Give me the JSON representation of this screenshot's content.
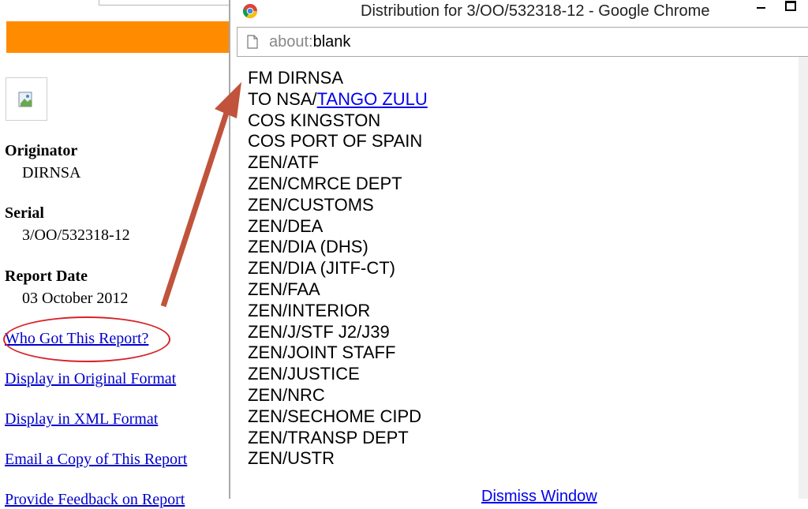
{
  "background_page": {
    "originator_label": "Originator",
    "originator_value": "DIRNSA",
    "serial_label": "Serial",
    "serial_value": "3/OO/532318-12",
    "report_date_label": "Report Date",
    "report_date_value": "03 October 2012",
    "links": {
      "who_got": "Who Got This Report?",
      "original_format": "Display in Original Format",
      "xml_format": "Display in XML Format",
      "email_copy": "Email a Copy of This Report",
      "feedback": "Provide Feedback on Report"
    },
    "colors": {
      "banner": "#ff8c00",
      "highlight": "#d9222a",
      "arrow": "#c0533b"
    }
  },
  "popup": {
    "window_title": "Distribution for 3/OO/532318-12 - Google Chrome",
    "address_prefix": "about:",
    "address_rest": "blank",
    "lines": {
      "fm": "FM DIRNSA",
      "to_prefix": "TO NSA/",
      "to_link": "TANGO ZULU",
      "l3": "COS KINGSTON",
      "l4": "COS PORT OF SPAIN",
      "l5": "ZEN/ATF",
      "l6": "ZEN/CMRCE DEPT",
      "l7": "ZEN/CUSTOMS",
      "l8": "ZEN/DEA",
      "l9": "ZEN/DIA (DHS)",
      "l10": "ZEN/DIA (JITF-CT)",
      "l11": "ZEN/FAA",
      "l12": "ZEN/INTERIOR",
      "l13": "ZEN/J/STF J2/J39",
      "l14": "ZEN/JOINT STAFF",
      "l15": "ZEN/JUSTICE",
      "l16": "ZEN/NRC",
      "l17": "ZEN/SECHOME CIPD",
      "l18": "ZEN/TRANSP DEPT",
      "l19": "ZEN/USTR"
    },
    "dismiss": "Dismiss Window"
  }
}
